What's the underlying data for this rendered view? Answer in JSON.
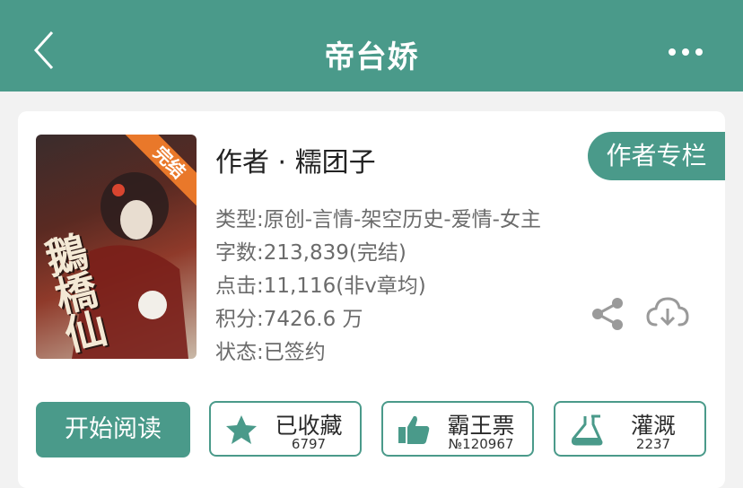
{
  "header": {
    "title": "帝台娇"
  },
  "book": {
    "cover_badge": "完结",
    "cover_title": "鵝橋仙",
    "author_line": "作者 · 糯团子",
    "author_column_label": "作者专栏",
    "meta": {
      "category": "类型:原创-言情-架空历史-爱情-女主",
      "word_count": "字数:213,839(完结)",
      "clicks": "点击:11,116(非v章均)",
      "score": "积分:7426.6 万",
      "status": "状态:已签约"
    }
  },
  "actions": {
    "read_label": "开始阅读",
    "favorite": {
      "label": "已收藏",
      "count": "6797",
      "icon": "star-icon"
    },
    "ticket": {
      "label": "霸王票",
      "count": "№120967",
      "icon": "thumbs-up-icon"
    },
    "nourish": {
      "label": "灌溉",
      "count": "2237",
      "icon": "flask-icon"
    }
  },
  "colors": {
    "accent": "#4a9a8a",
    "badge": "#e9782a",
    "text_primary": "#222222",
    "text_secondary": "#6b6b6b"
  }
}
